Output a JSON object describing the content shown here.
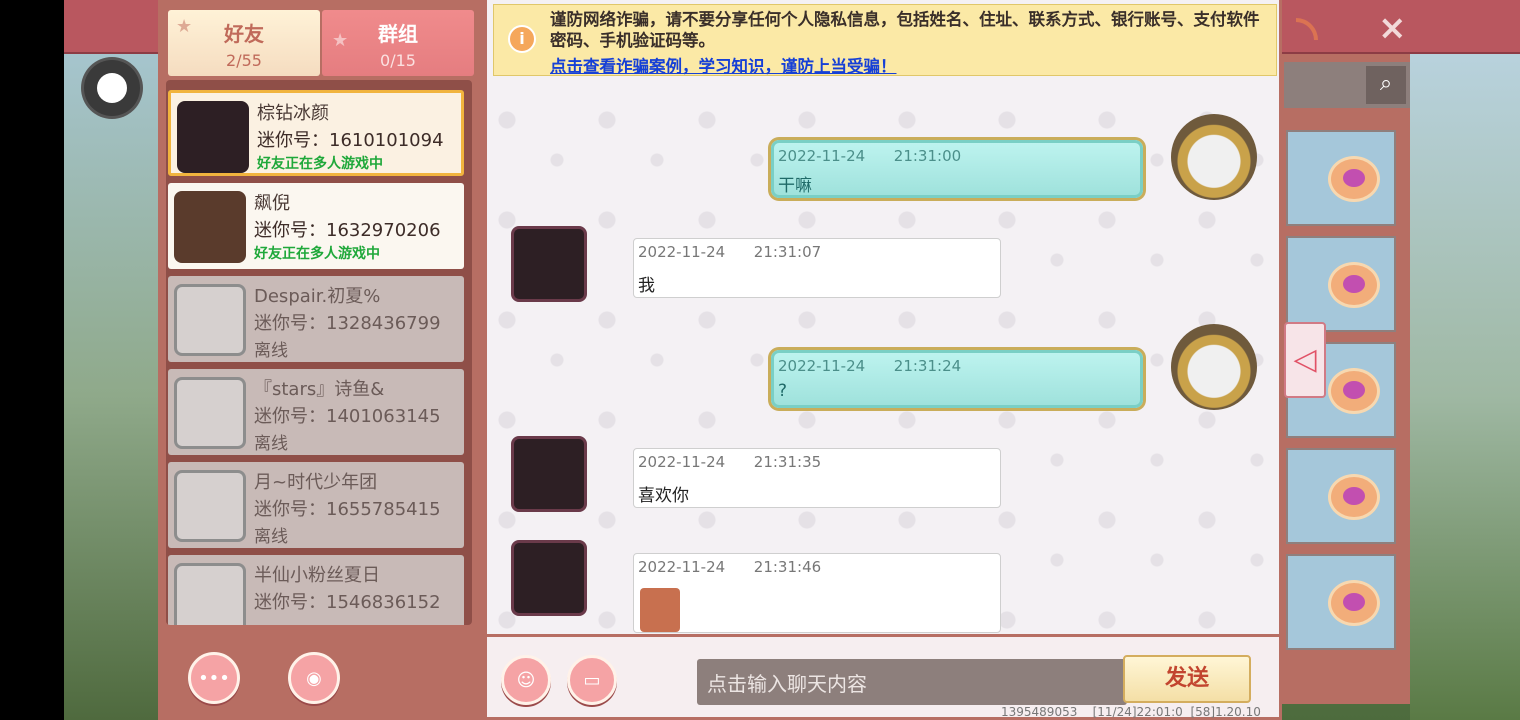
{
  "tabs": {
    "friends": {
      "label": "好友",
      "count": "2/55"
    },
    "groups": {
      "label": "群组",
      "count": "0/15"
    }
  },
  "friends": [
    {
      "name": "棕钻冰颜",
      "mini_id": "迷你号：1610101094",
      "status": "好友正在多人游戏中",
      "state": "selected"
    },
    {
      "name": "飙倪",
      "mini_id": "迷你号：1632970206",
      "status": "好友正在多人游戏中",
      "state": "online"
    },
    {
      "name": "Despair.初夏%",
      "mini_id": "迷你号：1328436799",
      "status": "离线",
      "state": "offline"
    },
    {
      "name": "『stars』诗鱼&",
      "mini_id": "迷你号：1401063145",
      "status": "离线",
      "state": "offline"
    },
    {
      "name": "月~时代少年团",
      "mini_id": "迷你号：1655785415",
      "status": "离线",
      "state": "offline"
    },
    {
      "name": "半仙小粉丝夏日",
      "mini_id": "迷你号：1546836152",
      "status": "",
      "state": "offline"
    }
  ],
  "warning": {
    "text": "谨防网络诈骗，请不要分享任何个人隐私信息，包括姓名、住址、联系方式、银行账号、支付软件密码、手机验证码等。",
    "link": "点击查看诈骗案例，学习知识，谨防上当受骗！"
  },
  "messages": [
    {
      "side": "out",
      "time": "2022-11-24      21:31:00",
      "text": "干嘛"
    },
    {
      "side": "in",
      "time": "2022-11-24      21:31:07",
      "text": "我"
    },
    {
      "side": "out",
      "time": "2022-11-24      21:31:24",
      "text": "?"
    },
    {
      "side": "in",
      "time": "2022-11-24      21:31:35",
      "text": "喜欢你"
    },
    {
      "side": "in",
      "time": "2022-11-24      21:31:46",
      "text": ""
    }
  ],
  "input": {
    "placeholder": "点击输入聊天内容",
    "send_label": "发送"
  },
  "footer": {
    "info": "1395489053    [11/24]22:01:0  [58]1.20.10"
  },
  "icons": {
    "close": "×",
    "search": "⌕",
    "warning": "i",
    "collapse": "◁",
    "more": "•••"
  },
  "colors": {
    "panel": "#b76e63",
    "online_status": "#1fa83a",
    "send_text": "#c2452f",
    "link": "#1640d6"
  }
}
